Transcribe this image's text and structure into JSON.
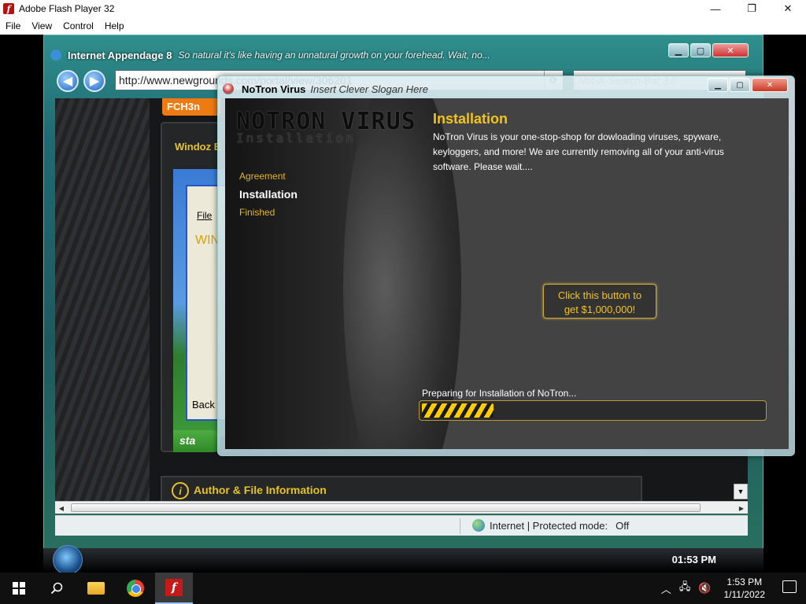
{
  "host_window": {
    "title": "Adobe Flash Player 32",
    "controls": {
      "minimize": "—",
      "maximize": "❐",
      "close": "✕"
    },
    "menu": [
      "File",
      "View",
      "Control",
      "Help"
    ]
  },
  "ie_window": {
    "title": "Internet Appendage 8",
    "slogan": "So natural it's like having an unnatural growth on your forehead.  Wait, no...",
    "address": "http://www.newgrounds.com/portal/view/306201",
    "search_placeholder": "Not-A-Search-Bar 3.0",
    "content": {
      "orange_tab": "FCH3n",
      "panel_title": "Windoz E",
      "xp_file_menu": "File",
      "xp_text": "WIN",
      "xp_back": "Back",
      "xp_start": "sta",
      "author_section": "Author & File Information"
    },
    "status": {
      "zone": "Internet | Protected mode:",
      "mode": "Off"
    },
    "taskbar_clock": "01:53 PM"
  },
  "installer": {
    "title": "NoTron Virus",
    "slogan": "Insert Clever Slogan Here",
    "logo_main": "NOTRON VIRUS",
    "logo_sub": "Installation",
    "steps": [
      {
        "label": "Agreement",
        "state": "done"
      },
      {
        "label": "Installation",
        "state": "active"
      },
      {
        "label": "Finished",
        "state": "pending"
      }
    ],
    "heading": "Installation",
    "description": "NoTron Virus is your one-stop-shop for dowloading viruses, spyware, keyloggers, and more!  We are currently removing all of your anti-virus software.  Please wait....",
    "money_button": {
      "line1": "Click this button to",
      "line2": "get $1,000,000!"
    },
    "progress_label": "Preparing for Installation of NoTron...",
    "progress": 0.21
  },
  "win10_taskbar": {
    "time": "1:53 PM",
    "date": "1/11/2022"
  },
  "colors": {
    "installer_accent": "#f2c31e",
    "installer_bg": "#434343",
    "flash_red": "#c41a1a"
  }
}
